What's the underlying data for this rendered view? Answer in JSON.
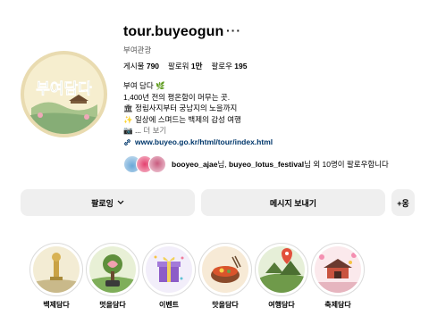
{
  "profile": {
    "username": "tour.buyeogun",
    "more_icon": "···",
    "category": "부여관광",
    "avatar_text": "부여담다"
  },
  "stats": {
    "posts_label": "게시물",
    "posts_value": "790",
    "followers_label": "팔로워",
    "followers_value": "1만",
    "following_label": "팔로우",
    "following_value": "195"
  },
  "bio": {
    "line1": "부여 담다 🌿",
    "line2": "1,400년 전의 평온함이 머무는 곳.",
    "line3": "🏛 정림사지부터 궁남지의 노을까지",
    "line4": "✨ 일상에 스며드는 백제의 감성 여행",
    "line5_prefix": "📷 ...",
    "more": "더 보기",
    "website": "www.buyeo.go.kr/html/tour/index.html"
  },
  "followed_by": {
    "user1": "booyeo_ajae",
    "mid": "님, ",
    "user2": "buyeo_lotus_festival",
    "suffix": "님 외 10명이 팔로우합니다"
  },
  "buttons": {
    "following": "팔로잉",
    "message": "메시지 보내기",
    "add_user": "+옹"
  },
  "highlights": [
    {
      "label": "백제담다",
      "icon": "statue-icon"
    },
    {
      "label": "멋을담다",
      "icon": "tree-icon"
    },
    {
      "label": "이벤트",
      "icon": "gift-icon"
    },
    {
      "label": "맛을담다",
      "icon": "food-icon"
    },
    {
      "label": "여행담다",
      "icon": "map-icon"
    },
    {
      "label": "축제담다",
      "icon": "festival-icon"
    }
  ],
  "colors": {
    "link": "#00376b",
    "button_bg": "#efefef",
    "avatar_bg": "#f3e9c6"
  }
}
